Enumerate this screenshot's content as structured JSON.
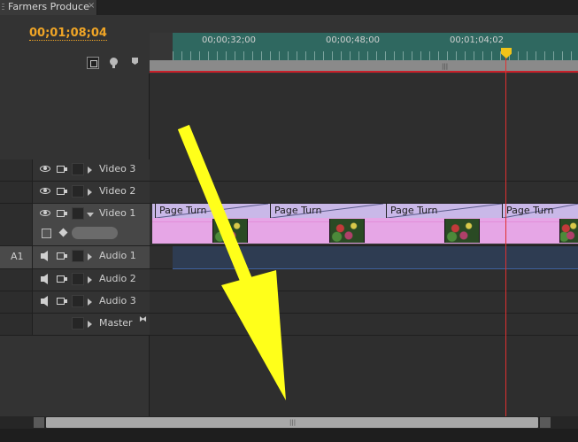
{
  "panel": {
    "tab_title": "Farmers Produce",
    "close_glyph": "×"
  },
  "timecode": "00;01;08;04",
  "ruler": {
    "labels": [
      "00;00;32;00",
      "00;00;48;00",
      "00;01;04;02"
    ]
  },
  "toolbar": {
    "icons": [
      "snap-icon",
      "set-marker-icon",
      "set-in-flag-icon"
    ]
  },
  "tracks": {
    "video3": {
      "name": "Video 3"
    },
    "video2": {
      "name": "Video 2"
    },
    "video1": {
      "name": "Video 1"
    },
    "audio1": {
      "name": "Audio 1",
      "source": "A1"
    },
    "audio2": {
      "name": "Audio 2"
    },
    "audio3": {
      "name": "Audio 3"
    },
    "master": {
      "name": "Master"
    }
  },
  "transitions": [
    "Page Turn",
    "Page Turn",
    "Page Turn",
    "Page Turn"
  ],
  "colors": {
    "timecode": "#f0a526",
    "ruler": "#2f6860",
    "playhead": "#e03030",
    "video_clip": "#e6a6e6",
    "transition": "#c9b8e8",
    "annotation_arrow": "#ffff1a"
  },
  "annotation": {
    "type": "arrow",
    "color": "#ffff1a"
  }
}
